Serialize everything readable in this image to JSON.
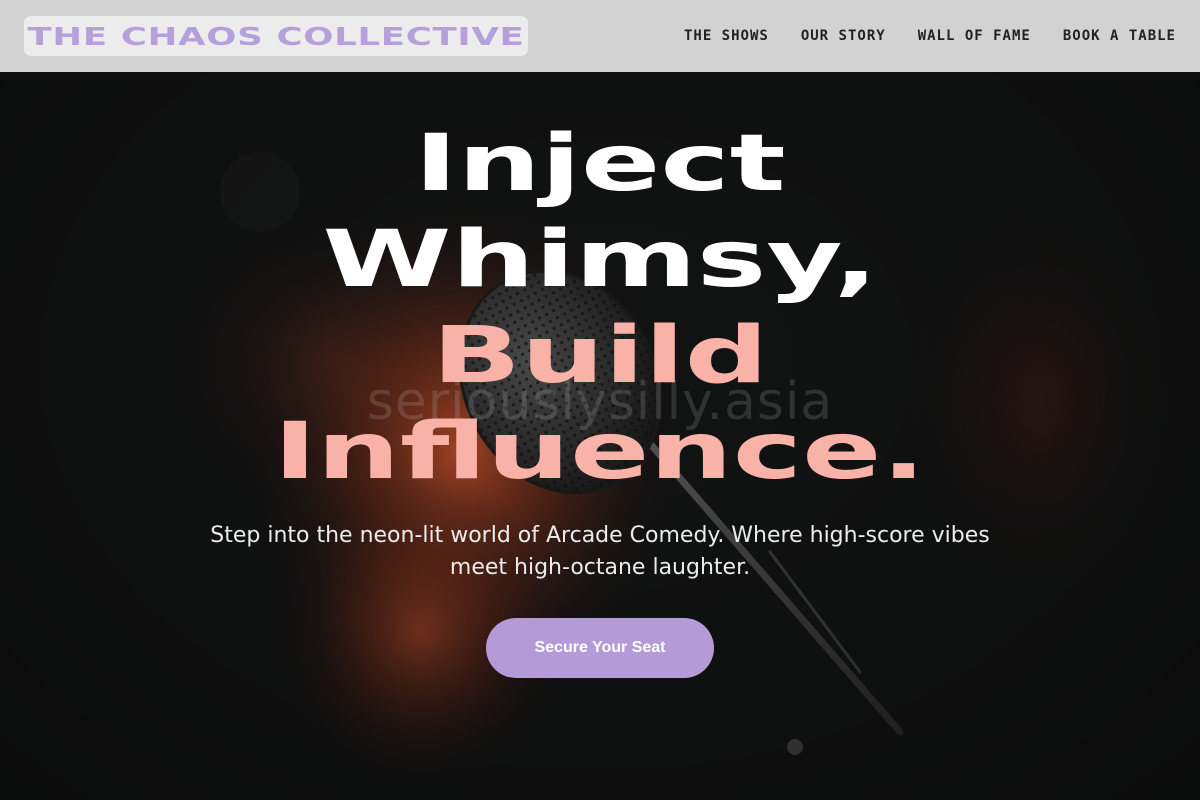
{
  "header": {
    "logo_text": "THE CHAOS COLLECTIVE",
    "nav": [
      {
        "label": "THE SHOWS"
      },
      {
        "label": "OUR STORY"
      },
      {
        "label": "WALL OF FAME"
      },
      {
        "label": "BOOK A TABLE"
      }
    ]
  },
  "hero": {
    "headline_lines": [
      "Inject",
      "Whimsy,",
      "Build",
      "Influence."
    ],
    "watermark": "seriouslysilly.asia",
    "subtitle": "Step into the neon-lit world of Arcade Comedy. Where high-score vibes meet high-octane laughter.",
    "cta_label": "Secure Your Seat",
    "background_image": "microphone-photo"
  },
  "colors": {
    "header_bg": "#d2d2d2",
    "logo_bg": "#ececec",
    "logo_text": "#b6a0dc",
    "nav_text": "#222222",
    "headline_white": "#ffffff",
    "headline_pink": "#f8b2a8",
    "cta_bg": "#b49ad6",
    "hero_bg": "#121313"
  }
}
